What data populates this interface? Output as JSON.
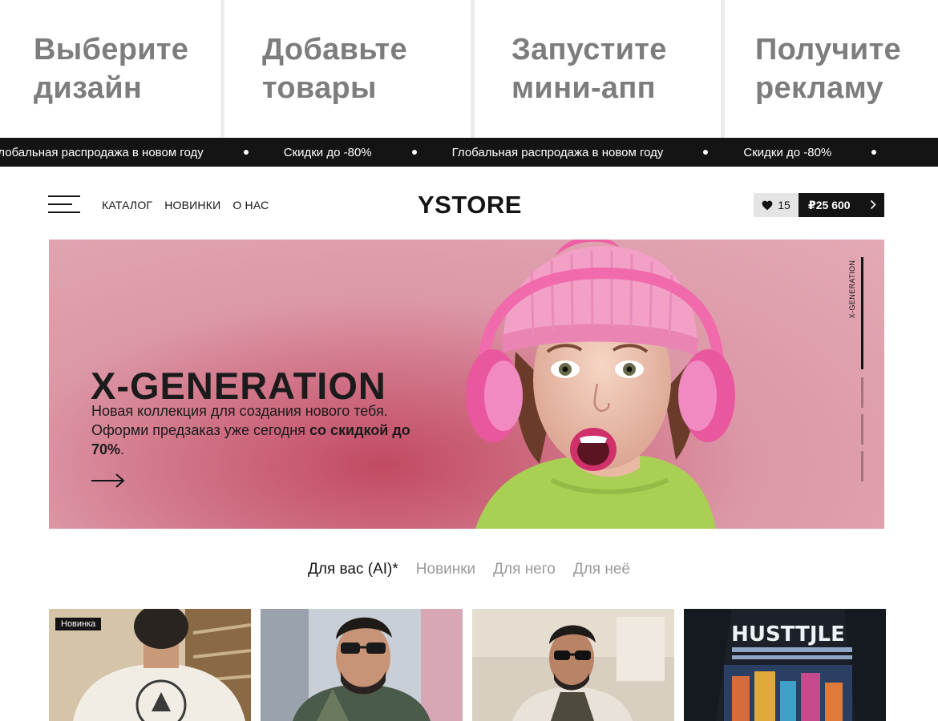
{
  "steps": [
    {
      "line1": "Выберите",
      "line2": "дизайн"
    },
    {
      "line1": "Добавьте",
      "line2": "товары"
    },
    {
      "line1": "Запустите",
      "line2": "мини-апп"
    },
    {
      "line1": "Получите",
      "line2": "рекламу"
    }
  ],
  "marquee": {
    "items": [
      "Глобальная распродажа в новом году",
      "Скидки до -80%",
      "Глобальная распродажа в новом году",
      "Скидки до -80%"
    ]
  },
  "header": {
    "nav": [
      "КАТАЛОГ",
      "НОВИНКИ",
      "О НАС"
    ],
    "logo": "YSTORE",
    "favorites_count": "15",
    "cart_total": "₽25 600"
  },
  "hero": {
    "title": "X-GENERATION",
    "desc_line1": "Новая коллекция для создания нового тебя.",
    "desc_line2_plain": "Оформи предзаказ уже сегодня ",
    "desc_line2_bold": "со скидкой до 70%",
    "desc_end": ".",
    "side_label": "X-GENERATION",
    "slide_count": 4,
    "active_slide": 1
  },
  "tabs": [
    "Для вас (AI)*",
    "Новинки",
    "Для него",
    "Для неё"
  ],
  "products": [
    {
      "badge": "Новинка"
    },
    {
      "badge": ""
    },
    {
      "badge": ""
    },
    {
      "print_text": "HUSTTJLE"
    }
  ],
  "colors": {
    "dark": "#141414",
    "step_text": "#7d7d7d",
    "hero_pink": "#e3a9b5",
    "tab_inactive": "#9a9a9a"
  }
}
